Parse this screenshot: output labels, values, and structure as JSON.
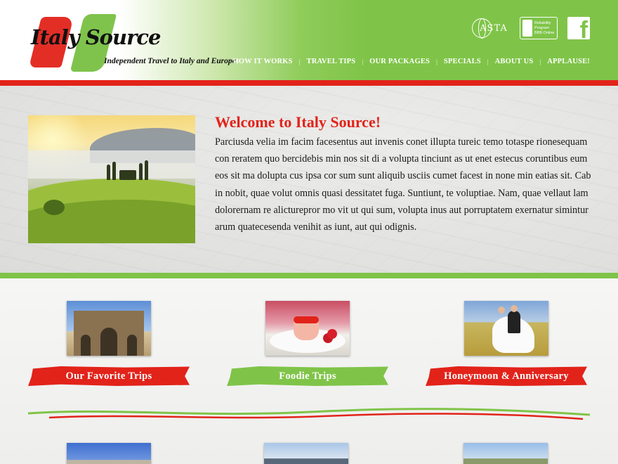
{
  "brand": {
    "logo_text": "Italy Source",
    "tagline": "Independent Travel to Italy and Europe"
  },
  "badges": {
    "asta": "ASTA",
    "bbb": [
      "Reliability",
      "Program",
      "BBB Online"
    ],
    "facebook": "f"
  },
  "nav": [
    {
      "label": "HOW IT WORKS"
    },
    {
      "label": "TRAVEL TIPS"
    },
    {
      "label": "OUR PACKAGES"
    },
    {
      "label": "SPECIALS"
    },
    {
      "label": "ABOUT US"
    },
    {
      "label": "APPLAUSE!"
    }
  ],
  "welcome": {
    "title": "Welcome to Italy Source!",
    "body": "Parciusda velia im facim facesentus aut invenis conet illupta tureic temo totaspe rionesequam con reratem quo bercidebis min nos sit di a volupta tinciunt as ut enet estecus coruntibus eum eos sit ma dolupta cus ipsa cor sum sunt aliquib usciis cumet facest in none min eatias sit. Cab in nobit, quae volut omnis quasi dessitatet fuga. Suntiunt, te voluptiae. Nam, quae vellaut lam dolorernam re alicturepror mo vit ut qui sum, volupta inus aut porruptatem exernatur simintur arum quatecesenda venihit as iunt, aut qui odignis."
  },
  "categories": [
    {
      "label": "Our Favorite Trips",
      "color": "#e2231a"
    },
    {
      "label": "Foodie Trips",
      "color": "#7fc448"
    },
    {
      "label": "Honeymoon & Anniversary",
      "color": "#e2231a"
    }
  ],
  "colors": {
    "red": "#e2231a",
    "green": "#7fc448"
  }
}
